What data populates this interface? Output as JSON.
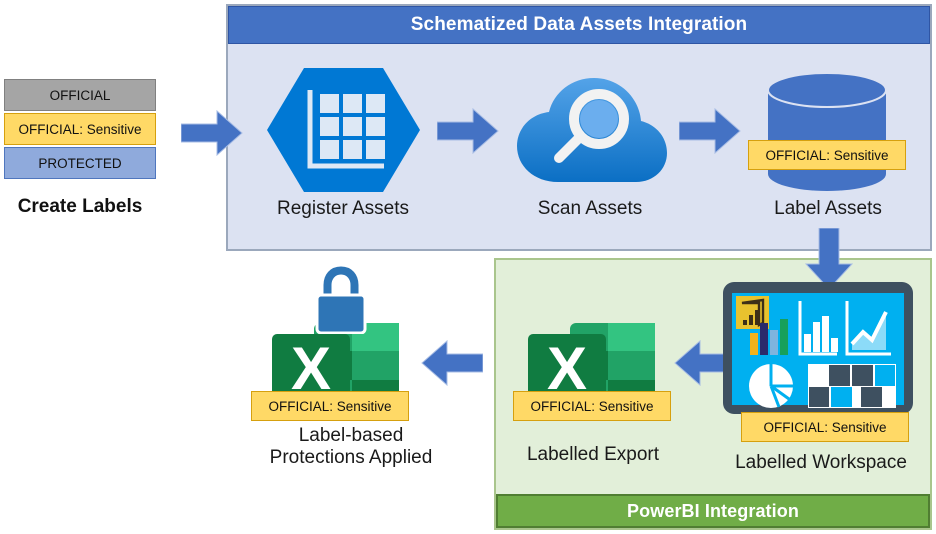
{
  "diagram": {
    "title": "Schematized Data Assets Integration",
    "footer_title": "PowerBI Integration"
  },
  "labels_stack": {
    "caption": "Create Labels",
    "items": [
      {
        "text": "OFFICIAL",
        "color": "#A5A5A5"
      },
      {
        "text": "OFFICIAL: Sensitive",
        "color": "#FFD966"
      },
      {
        "text": "PROTECTED",
        "color": "#8FAADC"
      }
    ]
  },
  "steps": {
    "register": {
      "caption": "Register Assets",
      "icon": "hexagon-grid-icon"
    },
    "scan": {
      "caption": "Scan Assets",
      "icon": "cloud-magnifier-icon"
    },
    "label_assets": {
      "caption": "Label Assets",
      "icon": "database-cylinder-icon",
      "chip": "OFFICIAL: Sensitive"
    },
    "workspace": {
      "caption": "Labelled Workspace",
      "icon": "powerbi-dashboard-icon",
      "chip": "OFFICIAL: Sensitive"
    },
    "export": {
      "caption": "Labelled Export",
      "icon": "excel-file-icon",
      "chip": "OFFICIAL: Sensitive"
    },
    "protections": {
      "caption_line1": "Label-based",
      "caption_line2": "Protections Applied",
      "icon": "excel-file-locked-icon",
      "chip": "OFFICIAL: Sensitive"
    }
  },
  "colors": {
    "header_blue": "#4472C4",
    "footer_green": "#70AD47",
    "container_blue_fill": "#DCE2F2",
    "container_green_fill": "#E2EFD9",
    "arrow_blue": "#4472C4",
    "azure_blue": "#0078D4",
    "excel_green": "#107C41",
    "powerbi_cyan": "#00B0F0",
    "label_yellow": "#FFD966",
    "label_gray": "#A5A5A5",
    "label_blue": "#8FAADC"
  }
}
